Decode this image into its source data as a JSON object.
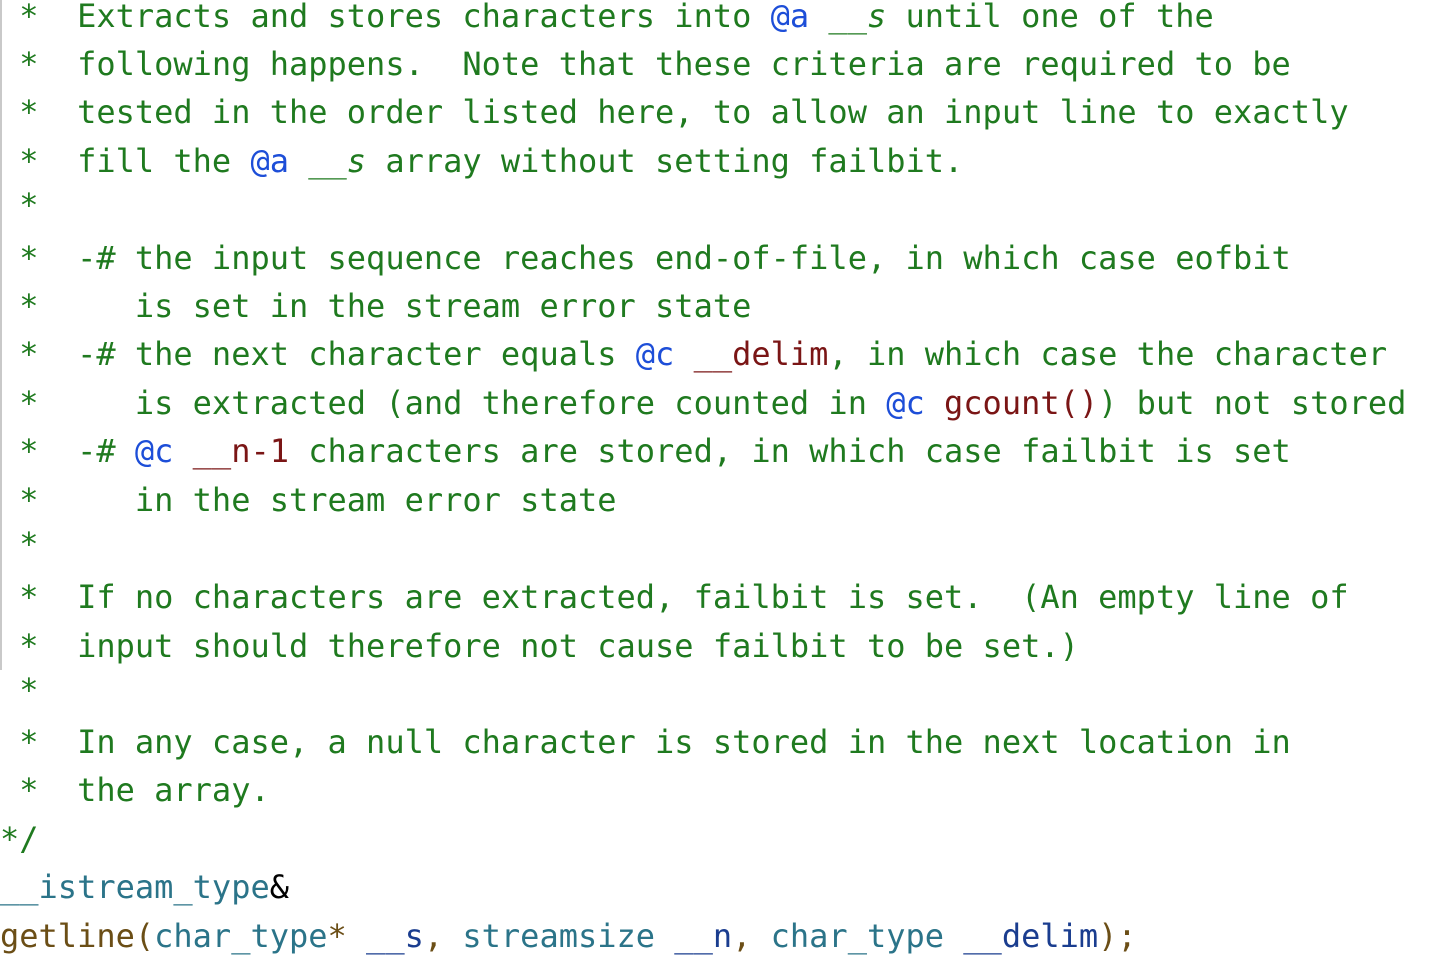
{
  "editor": {
    "lines": [
      {
        "tokens": [
          {
            "t": " *  ",
            "c": "c-comment"
          },
          {
            "t": "Extracts and stores characters into ",
            "c": "c-comment"
          },
          {
            "t": "@a",
            "c": "c-tag"
          },
          {
            "t": " ",
            "c": "c-comment"
          },
          {
            "t": "__s",
            "c": "c-comment c-ital"
          },
          {
            "t": " until one of the",
            "c": "c-comment"
          }
        ]
      },
      {
        "tokens": [
          {
            "t": " *  following happens.  Note that these criteria are required to be",
            "c": "c-comment"
          }
        ]
      },
      {
        "tokens": [
          {
            "t": " *  tested in the order listed here, to allow an input line to exactly",
            "c": "c-comment"
          }
        ]
      },
      {
        "tokens": [
          {
            "t": " *  fill the ",
            "c": "c-comment"
          },
          {
            "t": "@a",
            "c": "c-tag"
          },
          {
            "t": " ",
            "c": "c-comment"
          },
          {
            "t": "__s",
            "c": "c-comment c-ital"
          },
          {
            "t": " array without setting failbit.",
            "c": "c-comment"
          }
        ]
      },
      {
        "tokens": [
          {
            "t": " *",
            "c": "c-comment"
          }
        ]
      },
      {
        "tokens": [
          {
            "t": " *  -# the input sequence reaches end-of-file, in which case eofbit",
            "c": "c-comment"
          }
        ]
      },
      {
        "tokens": [
          {
            "t": " *     is set in the stream error state",
            "c": "c-comment"
          }
        ]
      },
      {
        "tokens": [
          {
            "t": " *  -# the next character equals ",
            "c": "c-comment"
          },
          {
            "t": "@c",
            "c": "c-tag"
          },
          {
            "t": " ",
            "c": "c-comment"
          },
          {
            "t": "__delim",
            "c": "c-ident"
          },
          {
            "t": ", in which case the character",
            "c": "c-comment"
          }
        ]
      },
      {
        "tokens": [
          {
            "t": " *     is extracted (and therefore counted in ",
            "c": "c-comment"
          },
          {
            "t": "@c",
            "c": "c-tag"
          },
          {
            "t": " ",
            "c": "c-comment"
          },
          {
            "t": "gcount()",
            "c": "c-ident"
          },
          {
            "t": ") but not stored",
            "c": "c-comment"
          }
        ]
      },
      {
        "tokens": [
          {
            "t": " *  -# ",
            "c": "c-comment"
          },
          {
            "t": "@c",
            "c": "c-tag"
          },
          {
            "t": " ",
            "c": "c-comment"
          },
          {
            "t": "__n-1",
            "c": "c-ident"
          },
          {
            "t": " characters are stored, in which case failbit is set",
            "c": "c-comment"
          }
        ]
      },
      {
        "tokens": [
          {
            "t": " *     in the stream error state",
            "c": "c-comment"
          }
        ]
      },
      {
        "tokens": [
          {
            "t": " *",
            "c": "c-comment"
          }
        ]
      },
      {
        "tokens": [
          {
            "t": " *  If no characters are extracted, failbit is set.  (An empty line of",
            "c": "c-comment"
          }
        ]
      },
      {
        "tokens": [
          {
            "t": " *  input should therefore not cause failbit to be set.)",
            "c": "c-comment"
          }
        ]
      },
      {
        "tokens": [
          {
            "t": " *",
            "c": "c-comment"
          }
        ]
      },
      {
        "tokens": [
          {
            "t": " *  In any case, a null character is stored in the next location in",
            "c": "c-comment"
          }
        ]
      },
      {
        "tokens": [
          {
            "t": " *  the array.",
            "c": "c-comment"
          }
        ]
      },
      {
        "tokens": [
          {
            "t": "*/",
            "c": "c-comment"
          }
        ]
      },
      {
        "tokens": [
          {
            "t": "__istream_type",
            "c": "c-type"
          },
          {
            "t": "&",
            "c": "c-punct"
          }
        ]
      },
      {
        "tokens": [
          {
            "t": "getline",
            "c": "c-func"
          },
          {
            "t": "(",
            "c": "c-func"
          },
          {
            "t": "char_type",
            "c": "c-type"
          },
          {
            "t": "* ",
            "c": "c-func"
          },
          {
            "t": "__s",
            "c": "c-param"
          },
          {
            "t": ", ",
            "c": "c-func"
          },
          {
            "t": "streamsize",
            "c": "c-type"
          },
          {
            "t": " ",
            "c": "c-func"
          },
          {
            "t": "__n",
            "c": "c-param"
          },
          {
            "t": ", ",
            "c": "c-func"
          },
          {
            "t": "char_type",
            "c": "c-type"
          },
          {
            "t": " ",
            "c": "c-func"
          },
          {
            "t": "__delim",
            "c": "c-param"
          },
          {
            "t": ");",
            "c": "c-func"
          }
        ]
      }
    ]
  },
  "colors": {
    "background": "#ffffff",
    "comment": "#1f7a1f",
    "doc_tag": "#1d4ed8",
    "identifier": "#7a1515",
    "type": "#2b7489",
    "function": "#6b4e16",
    "parameter": "#1a3d8f",
    "indent_guide": "#c9c9c9"
  }
}
